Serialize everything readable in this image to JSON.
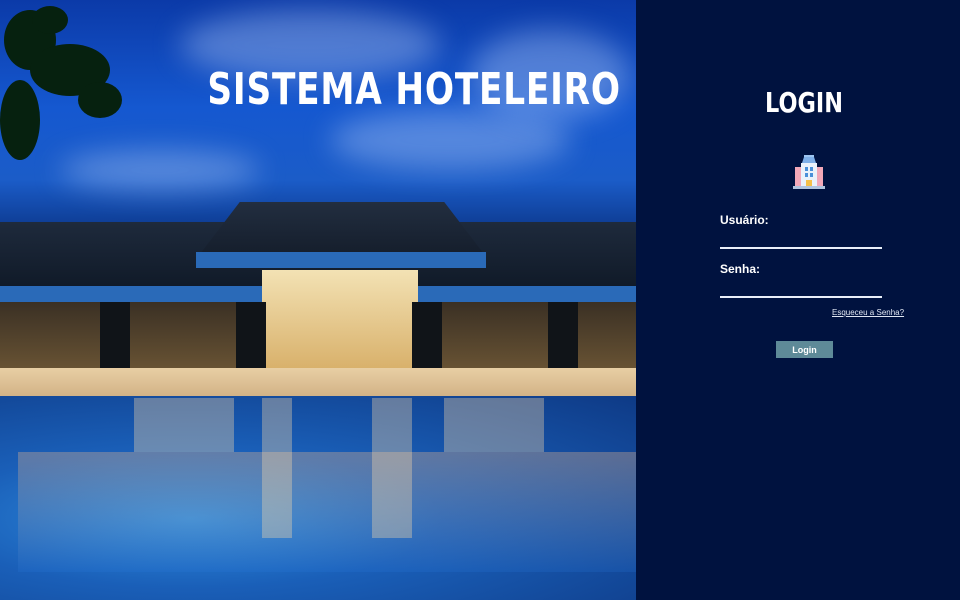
{
  "hero": {
    "title": "SISTEMA  HOTELEIRO"
  },
  "login": {
    "title": "LOGIN",
    "icon": "hotel-building-icon",
    "username_label": "Usuário:",
    "username_value": "",
    "password_label": "Senha:",
    "password_value": "",
    "forgot_link": "Esqueceu a Senha?",
    "submit_label": "Login"
  },
  "colors": {
    "panel_background": "#00123f",
    "button_background": "#5e8a98",
    "text": "#ffffff"
  }
}
